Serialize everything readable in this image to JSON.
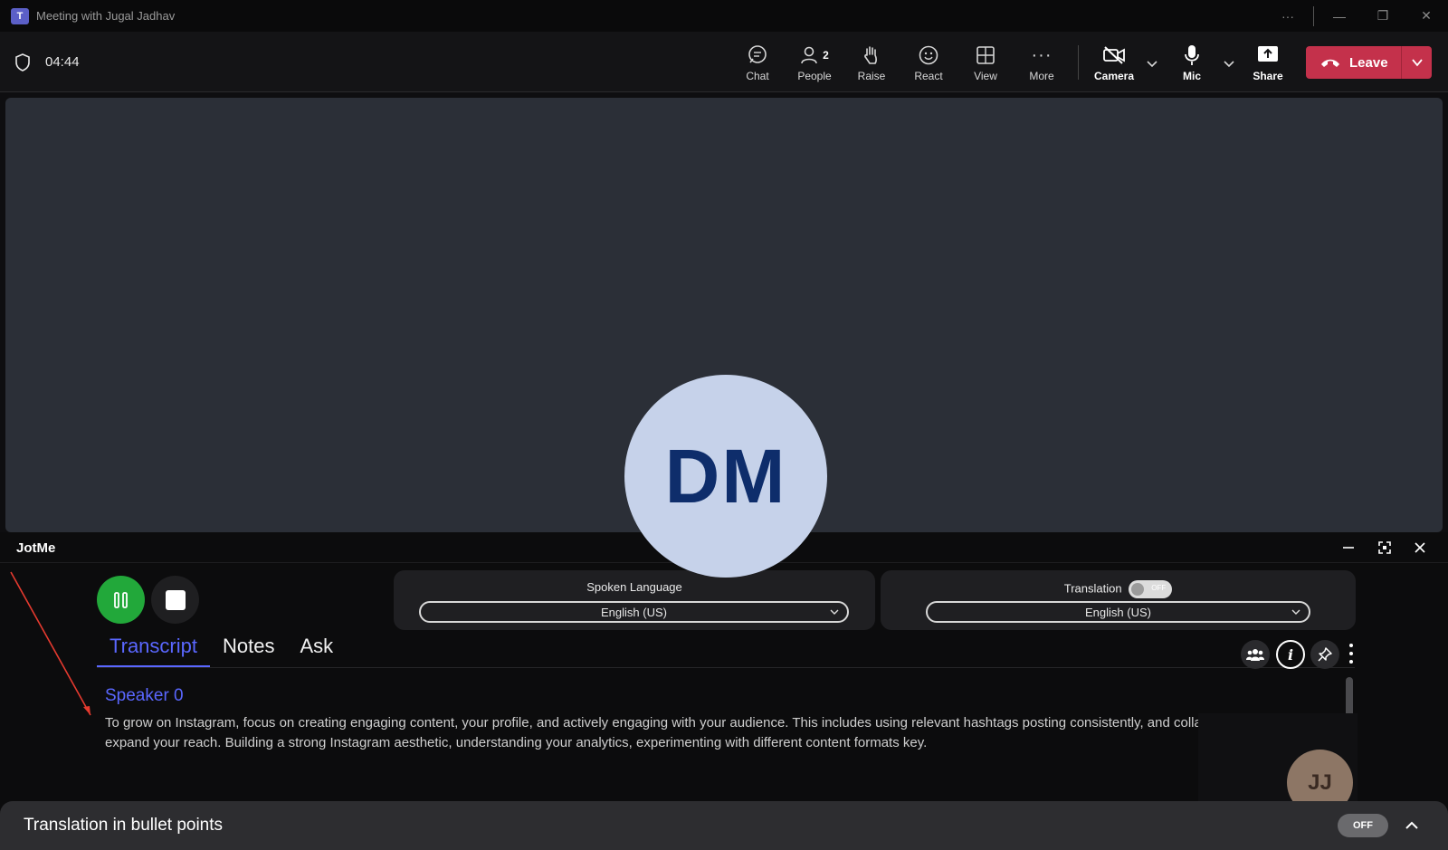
{
  "window": {
    "title": "Meeting with Jugal Jadhav",
    "app_icon": "teams-icon",
    "controls": [
      "more-icon",
      "minimize-icon",
      "restore-icon",
      "close-icon"
    ]
  },
  "meeting": {
    "timer": "04:44",
    "toolbar": {
      "chat": "Chat",
      "people": "People",
      "people_count": "2",
      "raise": "Raise",
      "react": "React",
      "view": "View",
      "more": "More",
      "camera": "Camera",
      "mic": "Mic",
      "share": "Share",
      "leave": "Leave"
    },
    "participant_initials": "DM"
  },
  "jotme": {
    "title": "JotMe",
    "spoken_language": {
      "label": "Spoken Language",
      "value": "English (US)"
    },
    "translation": {
      "label": "Translation",
      "toggle_text": "OFF",
      "value": "English (US)"
    },
    "tabs": [
      "Transcript",
      "Notes",
      "Ask"
    ],
    "active_tab": "Transcript",
    "speaker": "Speaker 0",
    "transcript": "To grow on Instagram, focus on creating engaging content, your profile, and actively engaging with your audience. This includes using relevant hashtags posting consistently, and collaborating with others to expand your reach. Building a strong Instagram aesthetic, understanding your analytics, experimenting with different content formats key.",
    "self_view_initials": "JJ",
    "bullet_bar": {
      "label": "Translation in bullet points",
      "toggle": "OFF"
    }
  },
  "colors": {
    "accent": "#5a67ff",
    "leave": "#c4314b",
    "record_green": "#22a83a",
    "stage": "#2b2f37"
  }
}
